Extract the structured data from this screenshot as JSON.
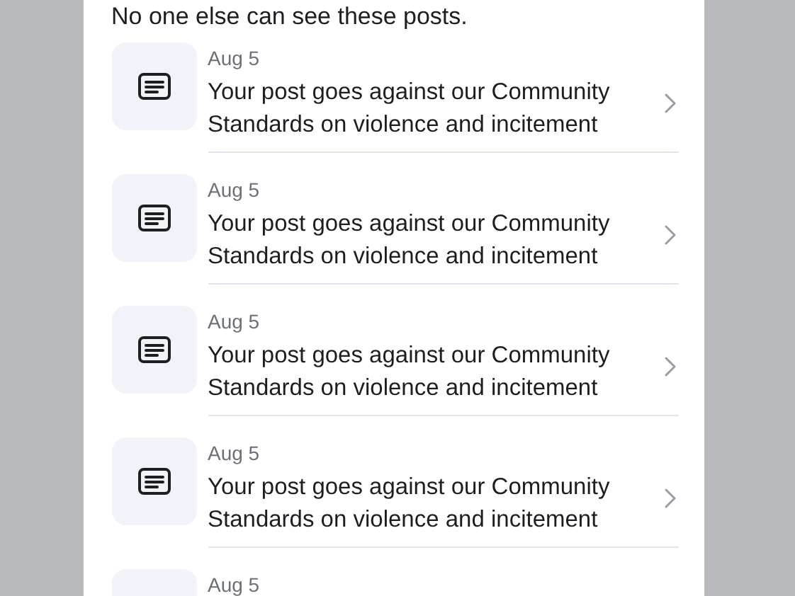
{
  "note": "No one else can see these posts.",
  "items": [
    {
      "date": "Aug 5",
      "message": "Your post goes against our Community Standards on violence and incitement"
    },
    {
      "date": "Aug 5",
      "message": "Your post goes against our Community Standards on violence and incitement"
    },
    {
      "date": "Aug 5",
      "message": "Your post goes against our Community Standards on violence and incitement"
    },
    {
      "date": "Aug 5",
      "message": "Your post goes against our Community Standards on violence and incitement"
    },
    {
      "date": "Aug 5"
    }
  ]
}
